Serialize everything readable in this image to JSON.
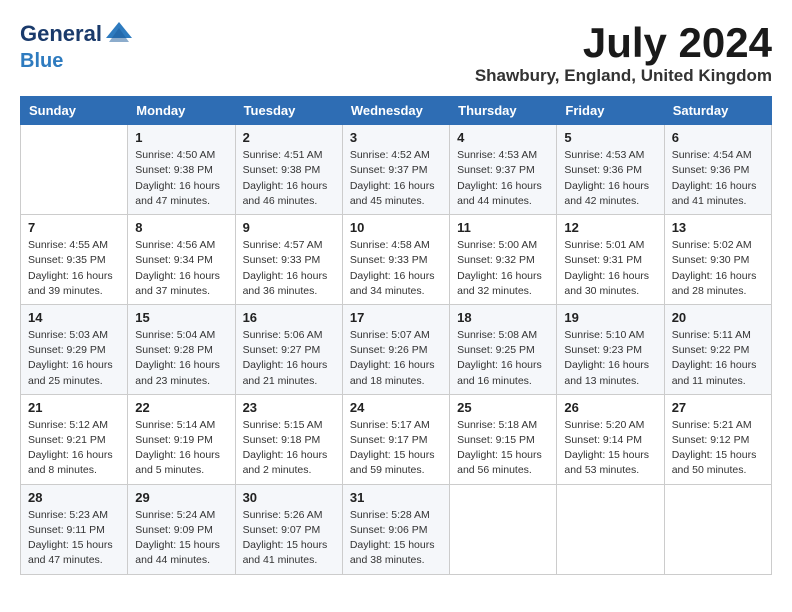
{
  "header": {
    "logo_line1": "General",
    "logo_line2": "Blue",
    "month_title": "July 2024",
    "location": "Shawbury, England, United Kingdom"
  },
  "weekdays": [
    "Sunday",
    "Monday",
    "Tuesday",
    "Wednesday",
    "Thursday",
    "Friday",
    "Saturday"
  ],
  "weeks": [
    [
      {
        "day": "",
        "info": ""
      },
      {
        "day": "1",
        "info": "Sunrise: 4:50 AM\nSunset: 9:38 PM\nDaylight: 16 hours\nand 47 minutes."
      },
      {
        "day": "2",
        "info": "Sunrise: 4:51 AM\nSunset: 9:38 PM\nDaylight: 16 hours\nand 46 minutes."
      },
      {
        "day": "3",
        "info": "Sunrise: 4:52 AM\nSunset: 9:37 PM\nDaylight: 16 hours\nand 45 minutes."
      },
      {
        "day": "4",
        "info": "Sunrise: 4:53 AM\nSunset: 9:37 PM\nDaylight: 16 hours\nand 44 minutes."
      },
      {
        "day": "5",
        "info": "Sunrise: 4:53 AM\nSunset: 9:36 PM\nDaylight: 16 hours\nand 42 minutes."
      },
      {
        "day": "6",
        "info": "Sunrise: 4:54 AM\nSunset: 9:36 PM\nDaylight: 16 hours\nand 41 minutes."
      }
    ],
    [
      {
        "day": "7",
        "info": "Sunrise: 4:55 AM\nSunset: 9:35 PM\nDaylight: 16 hours\nand 39 minutes."
      },
      {
        "day": "8",
        "info": "Sunrise: 4:56 AM\nSunset: 9:34 PM\nDaylight: 16 hours\nand 37 minutes."
      },
      {
        "day": "9",
        "info": "Sunrise: 4:57 AM\nSunset: 9:33 PM\nDaylight: 16 hours\nand 36 minutes."
      },
      {
        "day": "10",
        "info": "Sunrise: 4:58 AM\nSunset: 9:33 PM\nDaylight: 16 hours\nand 34 minutes."
      },
      {
        "day": "11",
        "info": "Sunrise: 5:00 AM\nSunset: 9:32 PM\nDaylight: 16 hours\nand 32 minutes."
      },
      {
        "day": "12",
        "info": "Sunrise: 5:01 AM\nSunset: 9:31 PM\nDaylight: 16 hours\nand 30 minutes."
      },
      {
        "day": "13",
        "info": "Sunrise: 5:02 AM\nSunset: 9:30 PM\nDaylight: 16 hours\nand 28 minutes."
      }
    ],
    [
      {
        "day": "14",
        "info": "Sunrise: 5:03 AM\nSunset: 9:29 PM\nDaylight: 16 hours\nand 25 minutes."
      },
      {
        "day": "15",
        "info": "Sunrise: 5:04 AM\nSunset: 9:28 PM\nDaylight: 16 hours\nand 23 minutes."
      },
      {
        "day": "16",
        "info": "Sunrise: 5:06 AM\nSunset: 9:27 PM\nDaylight: 16 hours\nand 21 minutes."
      },
      {
        "day": "17",
        "info": "Sunrise: 5:07 AM\nSunset: 9:26 PM\nDaylight: 16 hours\nand 18 minutes."
      },
      {
        "day": "18",
        "info": "Sunrise: 5:08 AM\nSunset: 9:25 PM\nDaylight: 16 hours\nand 16 minutes."
      },
      {
        "day": "19",
        "info": "Sunrise: 5:10 AM\nSunset: 9:23 PM\nDaylight: 16 hours\nand 13 minutes."
      },
      {
        "day": "20",
        "info": "Sunrise: 5:11 AM\nSunset: 9:22 PM\nDaylight: 16 hours\nand 11 minutes."
      }
    ],
    [
      {
        "day": "21",
        "info": "Sunrise: 5:12 AM\nSunset: 9:21 PM\nDaylight: 16 hours\nand 8 minutes."
      },
      {
        "day": "22",
        "info": "Sunrise: 5:14 AM\nSunset: 9:19 PM\nDaylight: 16 hours\nand 5 minutes."
      },
      {
        "day": "23",
        "info": "Sunrise: 5:15 AM\nSunset: 9:18 PM\nDaylight: 16 hours\nand 2 minutes."
      },
      {
        "day": "24",
        "info": "Sunrise: 5:17 AM\nSunset: 9:17 PM\nDaylight: 15 hours\nand 59 minutes."
      },
      {
        "day": "25",
        "info": "Sunrise: 5:18 AM\nSunset: 9:15 PM\nDaylight: 15 hours\nand 56 minutes."
      },
      {
        "day": "26",
        "info": "Sunrise: 5:20 AM\nSunset: 9:14 PM\nDaylight: 15 hours\nand 53 minutes."
      },
      {
        "day": "27",
        "info": "Sunrise: 5:21 AM\nSunset: 9:12 PM\nDaylight: 15 hours\nand 50 minutes."
      }
    ],
    [
      {
        "day": "28",
        "info": "Sunrise: 5:23 AM\nSunset: 9:11 PM\nDaylight: 15 hours\nand 47 minutes."
      },
      {
        "day": "29",
        "info": "Sunrise: 5:24 AM\nSunset: 9:09 PM\nDaylight: 15 hours\nand 44 minutes."
      },
      {
        "day": "30",
        "info": "Sunrise: 5:26 AM\nSunset: 9:07 PM\nDaylight: 15 hours\nand 41 minutes."
      },
      {
        "day": "31",
        "info": "Sunrise: 5:28 AM\nSunset: 9:06 PM\nDaylight: 15 hours\nand 38 minutes."
      },
      {
        "day": "",
        "info": ""
      },
      {
        "day": "",
        "info": ""
      },
      {
        "day": "",
        "info": ""
      }
    ]
  ]
}
